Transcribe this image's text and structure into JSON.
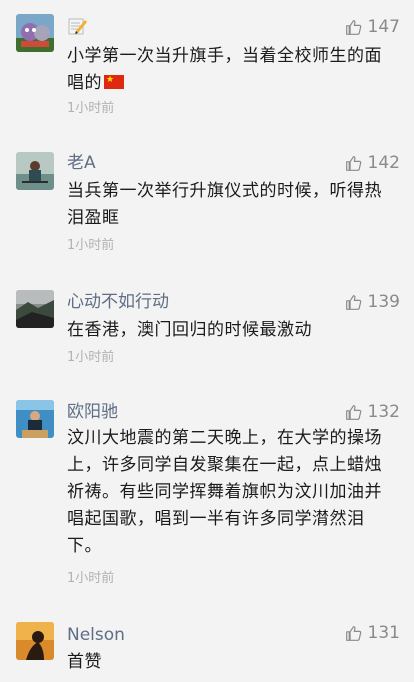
{
  "comments": [
    {
      "username": "",
      "likes": "147",
      "content": "小学第一次当升旗手，当着全校师生的面唱的",
      "time": "1小时前"
    },
    {
      "username": "老A",
      "likes": "142",
      "content": "当兵第一次举行升旗仪式的时候，听得热泪盈眶",
      "time": "1小时前"
    },
    {
      "username": "心动不如行动",
      "likes": "139",
      "content": "在香港，澳门回归的时候最激动",
      "time": "1小时前"
    },
    {
      "username": "欧阳驰",
      "likes": "132",
      "content": "汶川大地震的第二天晚上，在大学的操场上，许多同学自发聚集在一起，点上蜡烛祈祷。有些同学挥舞着旗帜为汶川加油并唱起国歌，唱到一半有许多同学潸然泪下。",
      "time": "1小时前"
    },
    {
      "username": "Nelson",
      "likes": "131",
      "content": "首赞",
      "time": ""
    }
  ],
  "icons": {
    "like": "thumbs-up-icon",
    "pencil": "pencil-emoji-icon",
    "flag": "china-flag-icon"
  },
  "colors": {
    "background": "#f3f3f3",
    "username": "#5f6e85",
    "text": "#1b1b1b",
    "meta": "#b2b2b2",
    "likes": "#8a8a8a"
  }
}
